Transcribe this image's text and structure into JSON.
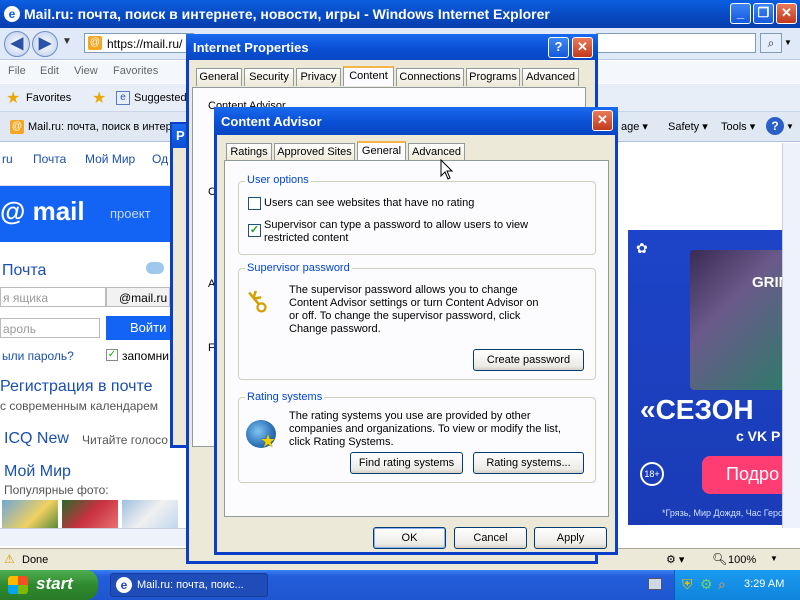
{
  "ie": {
    "title": "Mail.ru: почта, поиск в интернете, новости, игры - Windows Internet Explorer",
    "address": "https://mail.ru/",
    "menu": [
      "File",
      "Edit",
      "View",
      "Favorites"
    ],
    "favorites_label": "Favorites",
    "suggested_label": "Suggested",
    "tab_label": "Mail.ru: почта, поиск в интер...",
    "cmd": {
      "page": "age ▾",
      "safety": "Safety ▾",
      "tools": "Tools ▾"
    },
    "status": "Done",
    "zoom": "100%"
  },
  "mail": {
    "nav": [
      "ru",
      "Почта",
      "Мой Мир",
      "Од"
    ],
    "logo": "@ mail",
    "proekt": "проект",
    "pochta": "Почта",
    "login_placeholder": "я ящика",
    "domain": "@mail.ru",
    "password_placeholder": "ароль",
    "login_button": "Войти",
    "forgot": "ыли пароль?",
    "remember": "запомни",
    "register": "Регистрация в почте",
    "calendar": "с современным календарем",
    "icq": "ICQ New",
    "icq_sub": "Читайте голосо",
    "moimir": "Мой Мир",
    "photos": "Популярные фото:"
  },
  "ad": {
    "title": "«СЕЗОН",
    "vk": "с VK Р",
    "button": "Подро",
    "footer": "*Грязь, Мир Дождя, Час Героя, ",
    "grin": "GRIN",
    "age": "18+"
  },
  "internet_properties": {
    "title": "Internet Properties",
    "tabs": [
      "General",
      "Security",
      "Privacy",
      "Content",
      "Connections",
      "Programs",
      "Advanced"
    ],
    "peek_text": "Content Advisor",
    "shadow_title": "P",
    "shadow_letters": [
      "C",
      "A",
      "F"
    ]
  },
  "content_advisor": {
    "title": "Content Advisor",
    "tabs": [
      "Ratings",
      "Approved Sites",
      "General",
      "Advanced"
    ],
    "user_options": {
      "label": "User options",
      "opt1": "Users can see websites that have no rating",
      "opt1_checked": false,
      "opt2": "Supervisor can type a password to allow users to view restricted content",
      "opt2_checked": true
    },
    "supervisor": {
      "label": "Supervisor password",
      "text": "The supervisor password allows you to change Content Advisor settings or turn Content Advisor on or off. To change the supervisor password, click Change password.",
      "button": "Create password"
    },
    "rating": {
      "label": "Rating systems",
      "text": "The rating systems you use are provided by other companies and organizations. To view or modify the list, click Rating Systems.",
      "find_button": "Find rating systems",
      "systems_button": "Rating systems..."
    },
    "ok": "OK",
    "cancel": "Cancel",
    "apply": "Apply"
  },
  "taskbar": {
    "start": "start",
    "task": "Mail.ru: почта, поис...",
    "time": "3:29 AM"
  }
}
